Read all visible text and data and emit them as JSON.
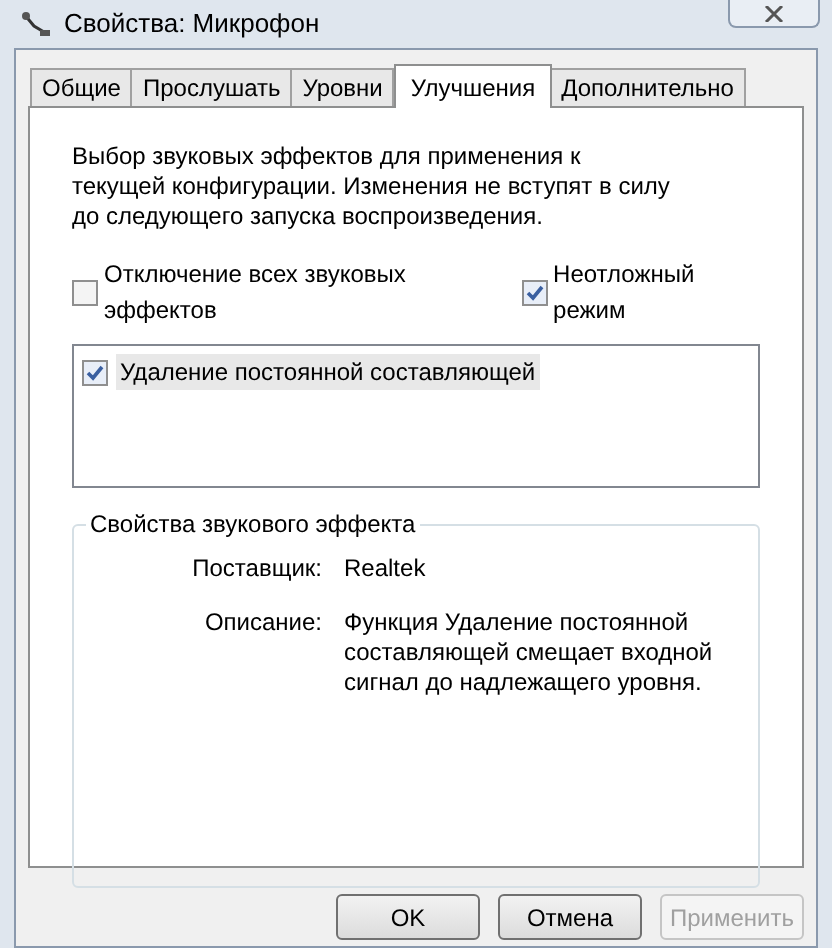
{
  "window": {
    "title": "Свойства: Микрофон"
  },
  "tabs": [
    {
      "label": "Общие",
      "selected": false
    },
    {
      "label": "Прослушать",
      "selected": false
    },
    {
      "label": "Уровни",
      "selected": false
    },
    {
      "label": "Улучшения",
      "selected": true
    },
    {
      "label": "Дополнительно",
      "selected": false
    }
  ],
  "intro": "Выбор звуковых эффектов для применения к текущей конфигурации. Изменения не вступят в силу до следующего запуска воспроизведения.",
  "options": [
    {
      "label": "Отключение всех звуковых эффектов",
      "checked": false
    },
    {
      "label": "Неотложный режим",
      "checked": true
    }
  ],
  "effects": [
    {
      "label": "Удаление постоянной составляющей",
      "checked": true,
      "selected": true
    }
  ],
  "properties": {
    "title": "Свойства звукового эффекта",
    "rows": [
      {
        "label": "Поставщик:",
        "value": "Realtek"
      },
      {
        "label": "Описание:",
        "value": "Функция Удаление постоянной составляющей смещает входной сигнал до надлежащего уровня."
      }
    ]
  },
  "buttons": [
    {
      "label": "OK",
      "disabled": false
    },
    {
      "label": "Отмена",
      "disabled": false
    },
    {
      "label": "Применить",
      "disabled": true
    }
  ]
}
